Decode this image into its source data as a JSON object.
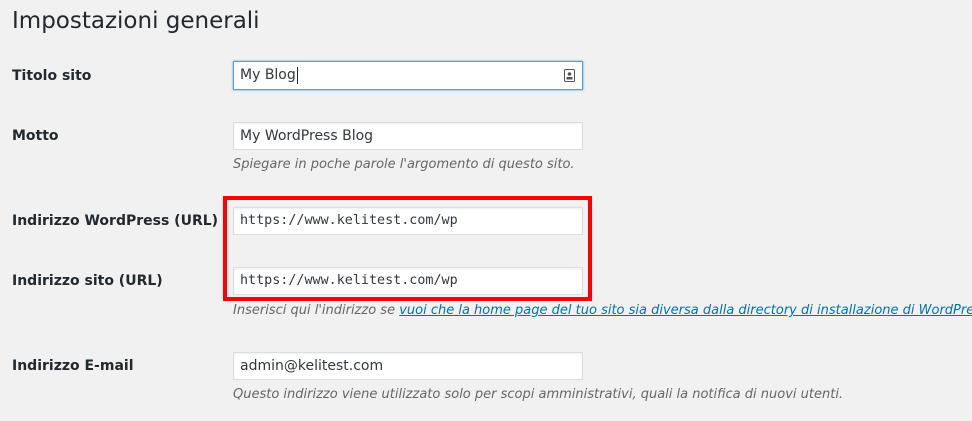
{
  "page": {
    "title": "Impostazioni generali"
  },
  "fields": {
    "site_title": {
      "label": "Titolo sito",
      "value": "My Blog"
    },
    "tagline": {
      "label": "Motto",
      "value": "My WordPress Blog",
      "description": "Spiegare in poche parole l'argomento di questo sito."
    },
    "wordpress_url": {
      "label": "Indirizzo WordPress (URL)",
      "value": "https://www.kelitest.com/wp"
    },
    "site_url": {
      "label": "Indirizzo sito (URL)",
      "value": "https://www.kelitest.com/wp",
      "description_prefix": "Inserisci qui l'indirizzo se ",
      "description_link": "vuoi che la home page del tuo sito sia diversa dalla directory di installazione di WordPress."
    },
    "admin_email": {
      "label": "Indirizzo E-mail",
      "value": "admin@kelitest.com",
      "description": "Questo indirizzo viene utilizzato solo per scopi amministrativi, quali la notifica di nuovi utenti."
    }
  },
  "colors": {
    "highlight": "#ff0000",
    "link": "#0073aa",
    "focus_border": "#5b9dd9",
    "background": "#f1f1f1"
  },
  "icons": {
    "site_title_field": "contact-card-icon"
  }
}
